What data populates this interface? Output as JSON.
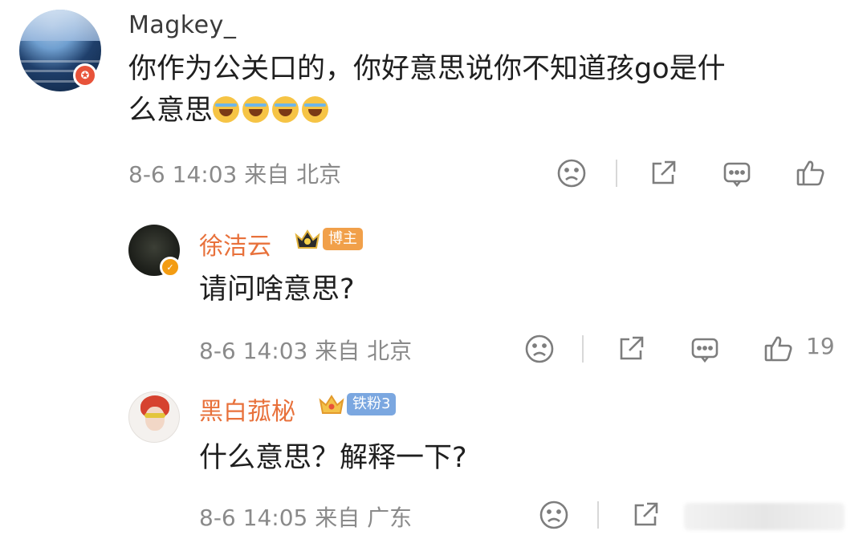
{
  "comments": [
    {
      "username": "Magkey_",
      "text_line1": "你作为公关口的，你好意思说你不知道孩go是什",
      "text_line2": "么意思",
      "emojis": [
        "laugh-cry-emoji",
        "laugh-cry-emoji",
        "laugh-cry-emoji",
        "laugh-cry-emoji"
      ],
      "time": "8-6 14:03",
      "location": "来自 北京",
      "like_count": ""
    },
    {
      "username": "徐洁云",
      "tag": "博主",
      "text": "请问啥意思?",
      "time": "8-6 14:03",
      "location": "来自 北京",
      "like_count": "19"
    },
    {
      "username": "黑白菰柲",
      "tag": "铁粉3",
      "text": "什么意思？解释一下?",
      "time": "8-6 14:05",
      "location": "来自 广东",
      "like_count": ""
    }
  ],
  "icons": {
    "dislike": "sad-face-icon",
    "share": "share-icon",
    "comment": "comment-icon",
    "like": "thumbs-up-icon",
    "crown": "crown-icon",
    "verified": "verified-badge-icon"
  },
  "colors": {
    "name_orange": "#e8713b",
    "host_tag": "#f1a04a",
    "fan_tag": "#7ba7e0",
    "meta_gray": "#8a8a8a"
  }
}
